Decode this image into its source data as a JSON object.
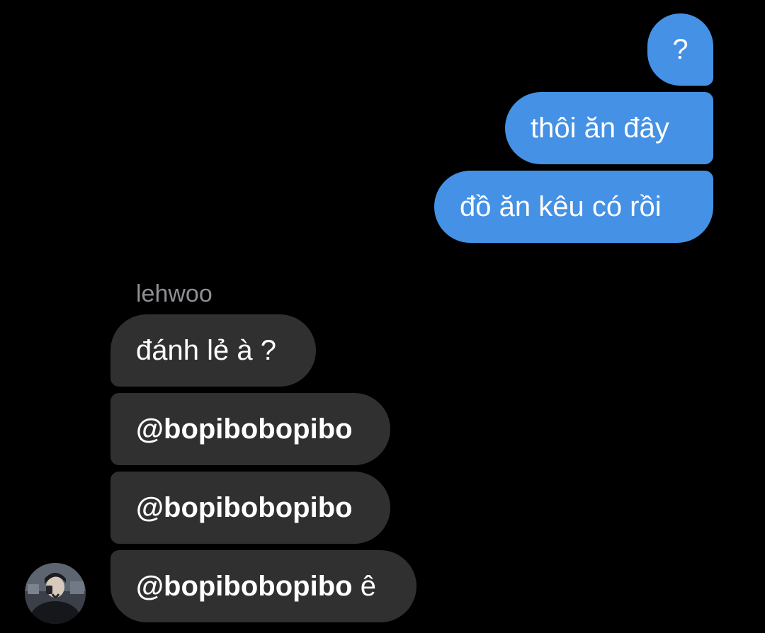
{
  "chat": {
    "outgoing": [
      {
        "text": "?"
      },
      {
        "text": "thôi ăn đây"
      },
      {
        "text": "đồ ăn kêu có rồi"
      }
    ],
    "sender_name": "lehwoo",
    "incoming": [
      {
        "text": "đánh lẻ à ?"
      },
      {
        "mention": "@bopibobopibo",
        "text": ""
      },
      {
        "mention": "@bopibobopibo",
        "text": ""
      },
      {
        "mention": "@bopibobopibo",
        "text": " ê"
      }
    ]
  },
  "colors": {
    "background": "#000000",
    "outgoing_bubble": "#4491E5",
    "incoming_bubble": "#303030",
    "sender_name": "#8e8e93"
  }
}
